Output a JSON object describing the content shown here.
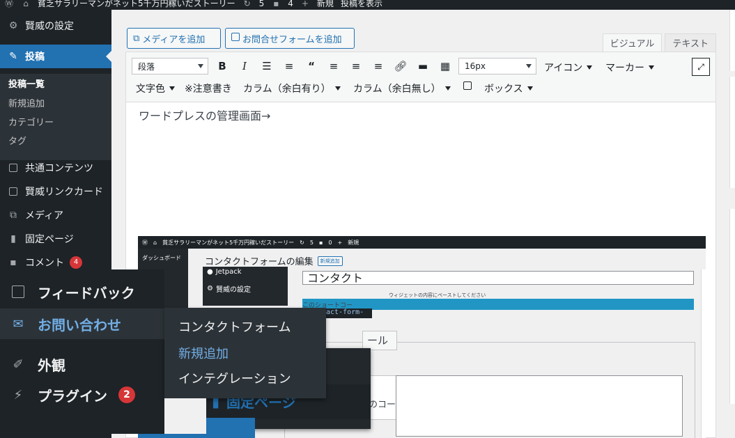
{
  "adminbar": {
    "site_title": "貧乏サラリーマンがネット5千万円稼いだストーリー",
    "updates": "5",
    "comments": "4",
    "new_label": "新規",
    "view_post": "投稿を表示"
  },
  "sidebar": {
    "items": [
      {
        "label": "賢威の設定",
        "icon": "gear-icon"
      },
      {
        "label": "投稿",
        "icon": "pin-icon"
      },
      {
        "label": "共通コンテンツ",
        "icon": "doc-icon"
      },
      {
        "label": "賢威リンクカード",
        "icon": "doc-icon"
      },
      {
        "label": "メディア",
        "icon": "media-icon"
      },
      {
        "label": "固定ページ",
        "icon": "page-icon"
      },
      {
        "label": "コメント",
        "icon": "comment-icon",
        "badge": "4"
      }
    ],
    "submenu": [
      "投稿一覧",
      "新規追加",
      "カテゴリー",
      "タグ"
    ]
  },
  "editor": {
    "add_media": "メディアを追加",
    "add_form": "お問合せフォームを追加",
    "tab_visual": "ビジュアル",
    "tab_text": "テキスト",
    "format_select": "段落",
    "fontsize_select": "16px",
    "dropdowns_row1": [
      "アイコン",
      "マーカー"
    ],
    "row2": {
      "text_color": "文字色",
      "note": "※注意書き",
      "col_margin": "カラム（余白有り）",
      "col_nomargin": "カラム（余白無し）",
      "box": "ボックス"
    },
    "content_text": "ワードプレスの管理画面→"
  },
  "screenshot": {
    "topbar_title": "貧乏サラリーマンがネット5千万円稼いだストーリー",
    "topbar_updates": "5",
    "topbar_comments": "0",
    "topbar_new": "新規",
    "sidebar_label": "ダッシュボード",
    "page_title": "コンタクトフォームの編集",
    "new_badge": "新規追加",
    "title_input": "コンタクト",
    "hint": "このショートコー",
    "hint2": "ウィジェットの内容にペーストしてください",
    "shortcode": "act-form-",
    "tab_fragment": "ール",
    "ta_fragment": "のコー",
    "jetpack": "Jetpack",
    "keni": "賢威の設定",
    "fixed_page": "固定ページ"
  },
  "overlay": {
    "feedback": "フィードバック",
    "contact": "お問い合わせ",
    "appearance": "外観",
    "plugins": "プラグイン",
    "plugins_badge": "2",
    "submenu": [
      "コンタクトフォーム",
      "新規追加",
      "インテグレーション"
    ]
  }
}
